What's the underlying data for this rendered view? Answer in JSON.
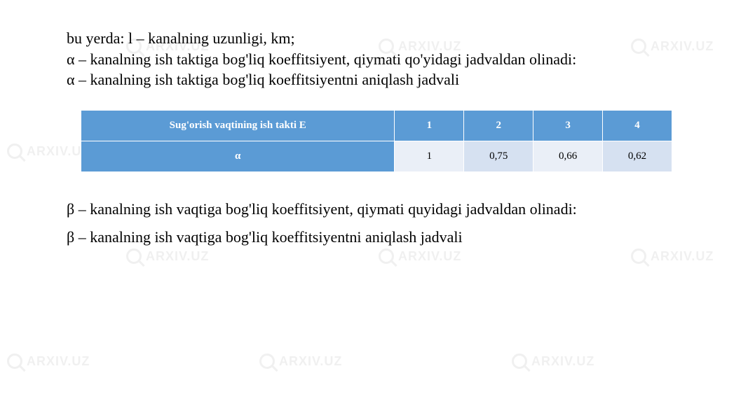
{
  "watermark_text": "ARXIV.UZ",
  "paragraphs": {
    "p1": "bu yerda: l – kanalning uzunligi, km;",
    "p2": "α – kanalning ish taktiga bog'liq koeffitsiyent, qiymati qo'yidagi jadvaldan olinadi:",
    "p3": "α – kanalning ish taktiga bog'liq koeffitsiyentni aniqlash jadvali",
    "p4": "β – kanalning ish vaqtiga bog'liq koeffitsiyent, qiymati quyidagi jadvaldan olinadi:",
    "p5": "β – kanalning ish vaqtiga bog'liq koeffitsiyentni aniqlash jadvali"
  },
  "table": {
    "header_label": "Sug'orish vaqtining ish takti E",
    "header_cols": [
      "1",
      "2",
      "3",
      "4"
    ],
    "row_label": "α",
    "row_values": [
      "1",
      "0,75",
      "0,66",
      "0,62"
    ]
  },
  "chart_data": {
    "type": "table",
    "title": "α – kanalning ish taktiga bog'liq koeffitsiyentni aniqlash jadvali",
    "columns": [
      "Sug'orish vaqtining ish takti E",
      "1",
      "2",
      "3",
      "4"
    ],
    "rows": [
      [
        "α",
        1,
        0.75,
        0.66,
        0.62
      ]
    ]
  }
}
